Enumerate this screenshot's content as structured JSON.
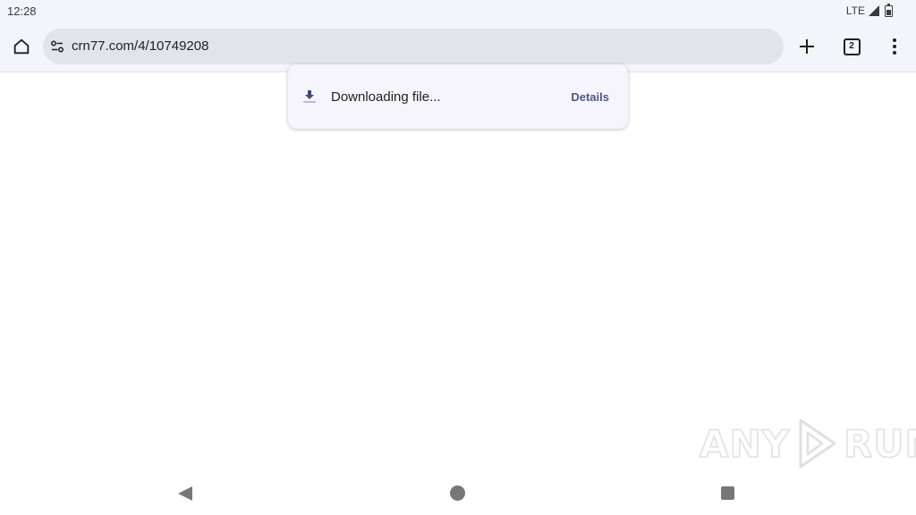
{
  "status_bar": {
    "time": "12:28",
    "network": "LTE",
    "icons": [
      "signal-icon",
      "battery-icon"
    ]
  },
  "toolbar": {
    "url": "crn77.com/4/10749208",
    "tab_count": "2",
    "icons": [
      "home-icon",
      "site-settings-icon",
      "plus-icon",
      "tab-switcher-icon",
      "more-vert-icon"
    ]
  },
  "download": {
    "message": "Downloading file...",
    "action_label": "Details",
    "icon": "download-icon"
  },
  "watermark": {
    "left": "ANY",
    "right": "RUN"
  },
  "nav_bar": {
    "icons": [
      "back-icon",
      "home-circle-icon",
      "recents-icon"
    ]
  }
}
